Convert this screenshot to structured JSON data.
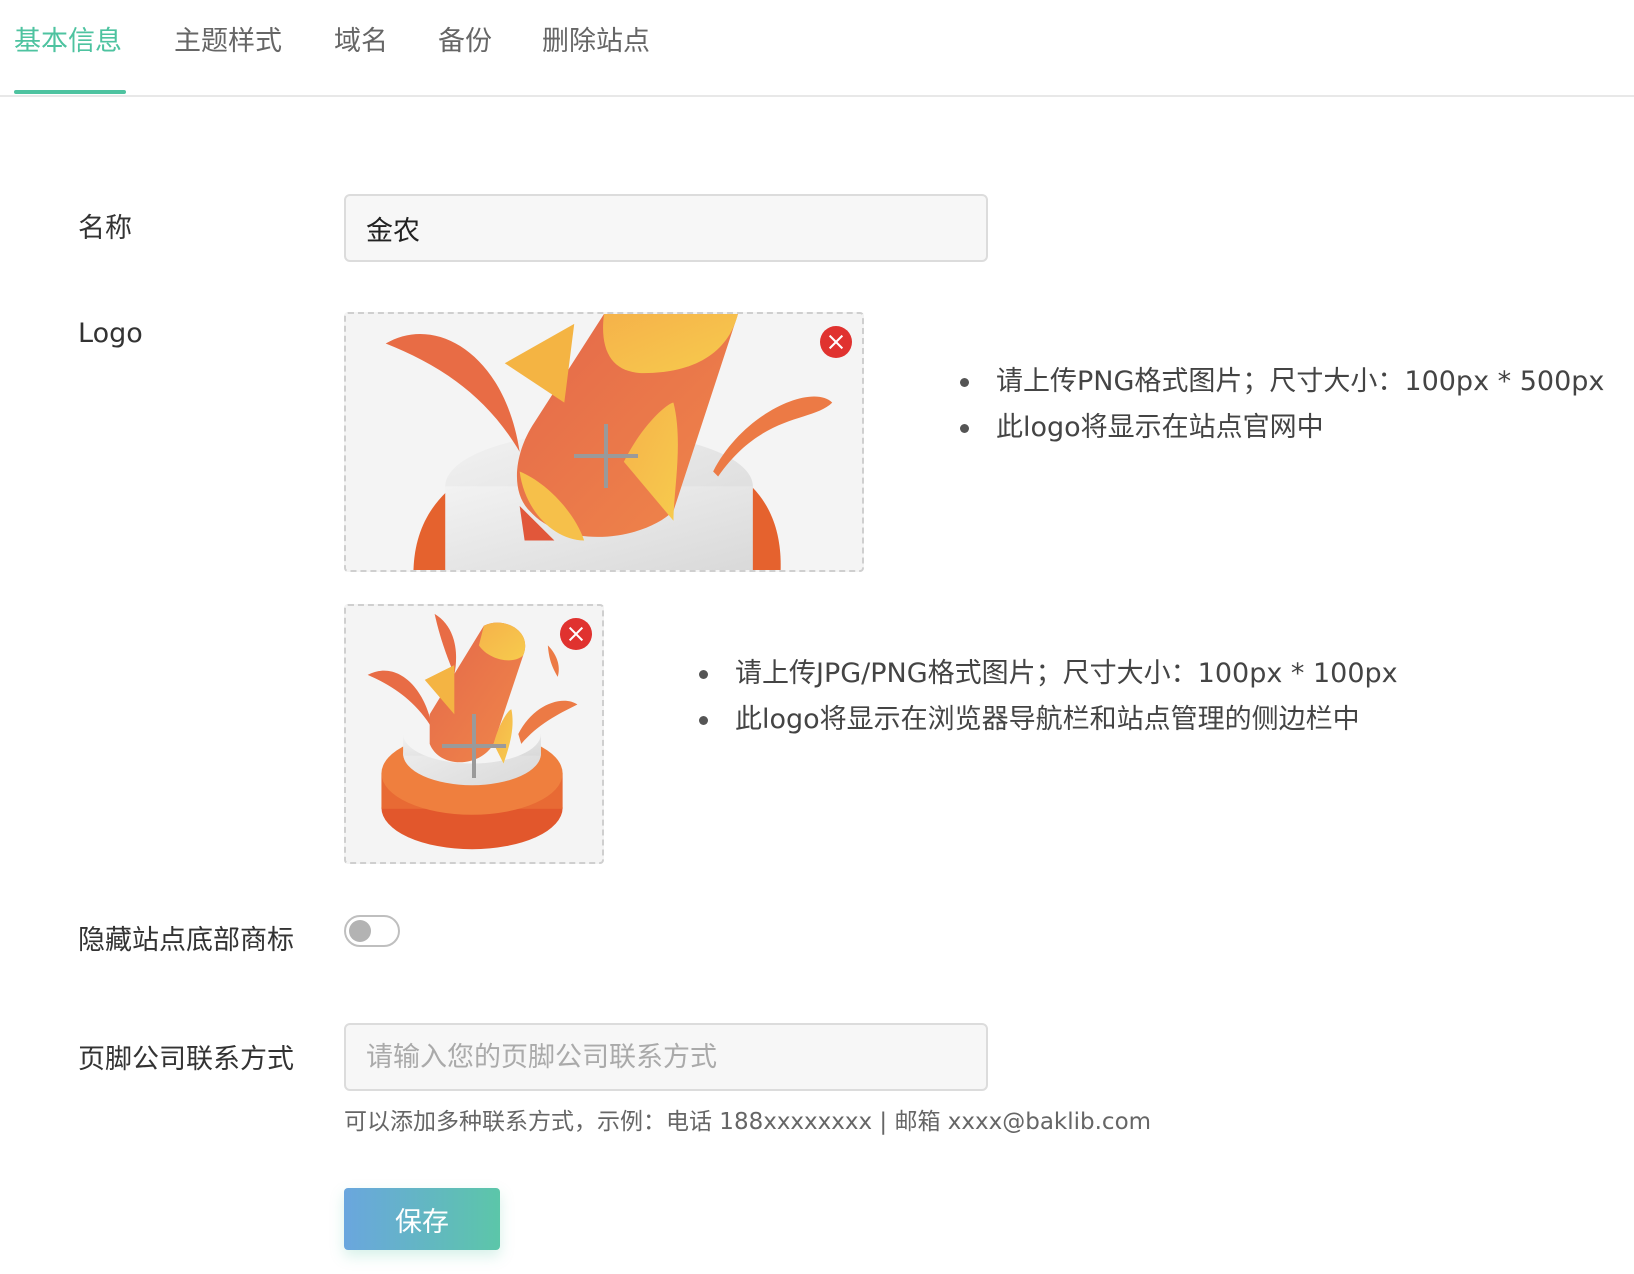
{
  "tabs": [
    {
      "label": "基本信息",
      "active": true
    },
    {
      "label": "主题样式",
      "active": false
    },
    {
      "label": "域名",
      "active": false
    },
    {
      "label": "备份",
      "active": false
    },
    {
      "label": "删除站点",
      "active": false
    }
  ],
  "colors": {
    "accent": "#4ec3a0",
    "remove": "#e0322f",
    "button_gradient_start": "#6aa6de",
    "button_gradient_end": "#5cc6a9"
  },
  "form": {
    "name": {
      "label": "名称",
      "value": "金农"
    },
    "logo": {
      "label": "Logo",
      "large": {
        "icons": [
          "plus-icon",
          "remove-icon"
        ],
        "hints": [
          "请上传PNG格式图片；尺寸大小：100px * 500px",
          "此logo将显示在站点官网中"
        ]
      },
      "small": {
        "icons": [
          "plus-icon",
          "remove-icon"
        ],
        "hints": [
          "请上传JPG/PNG格式图片；尺寸大小：100px * 100px",
          "此logo将显示在浏览器导航栏和站点管理的侧边栏中"
        ]
      }
    },
    "hide_footer_brand": {
      "label": "隐藏站点底部商标",
      "enabled": false
    },
    "footer_contact": {
      "label": "页脚公司联系方式",
      "value": "",
      "placeholder": "请输入您的页脚公司联系方式",
      "help": "可以添加多种联系方式，示例：电话 188xxxxxxxx | 邮箱 xxxx@baklib.com"
    },
    "save_label": "保存"
  }
}
